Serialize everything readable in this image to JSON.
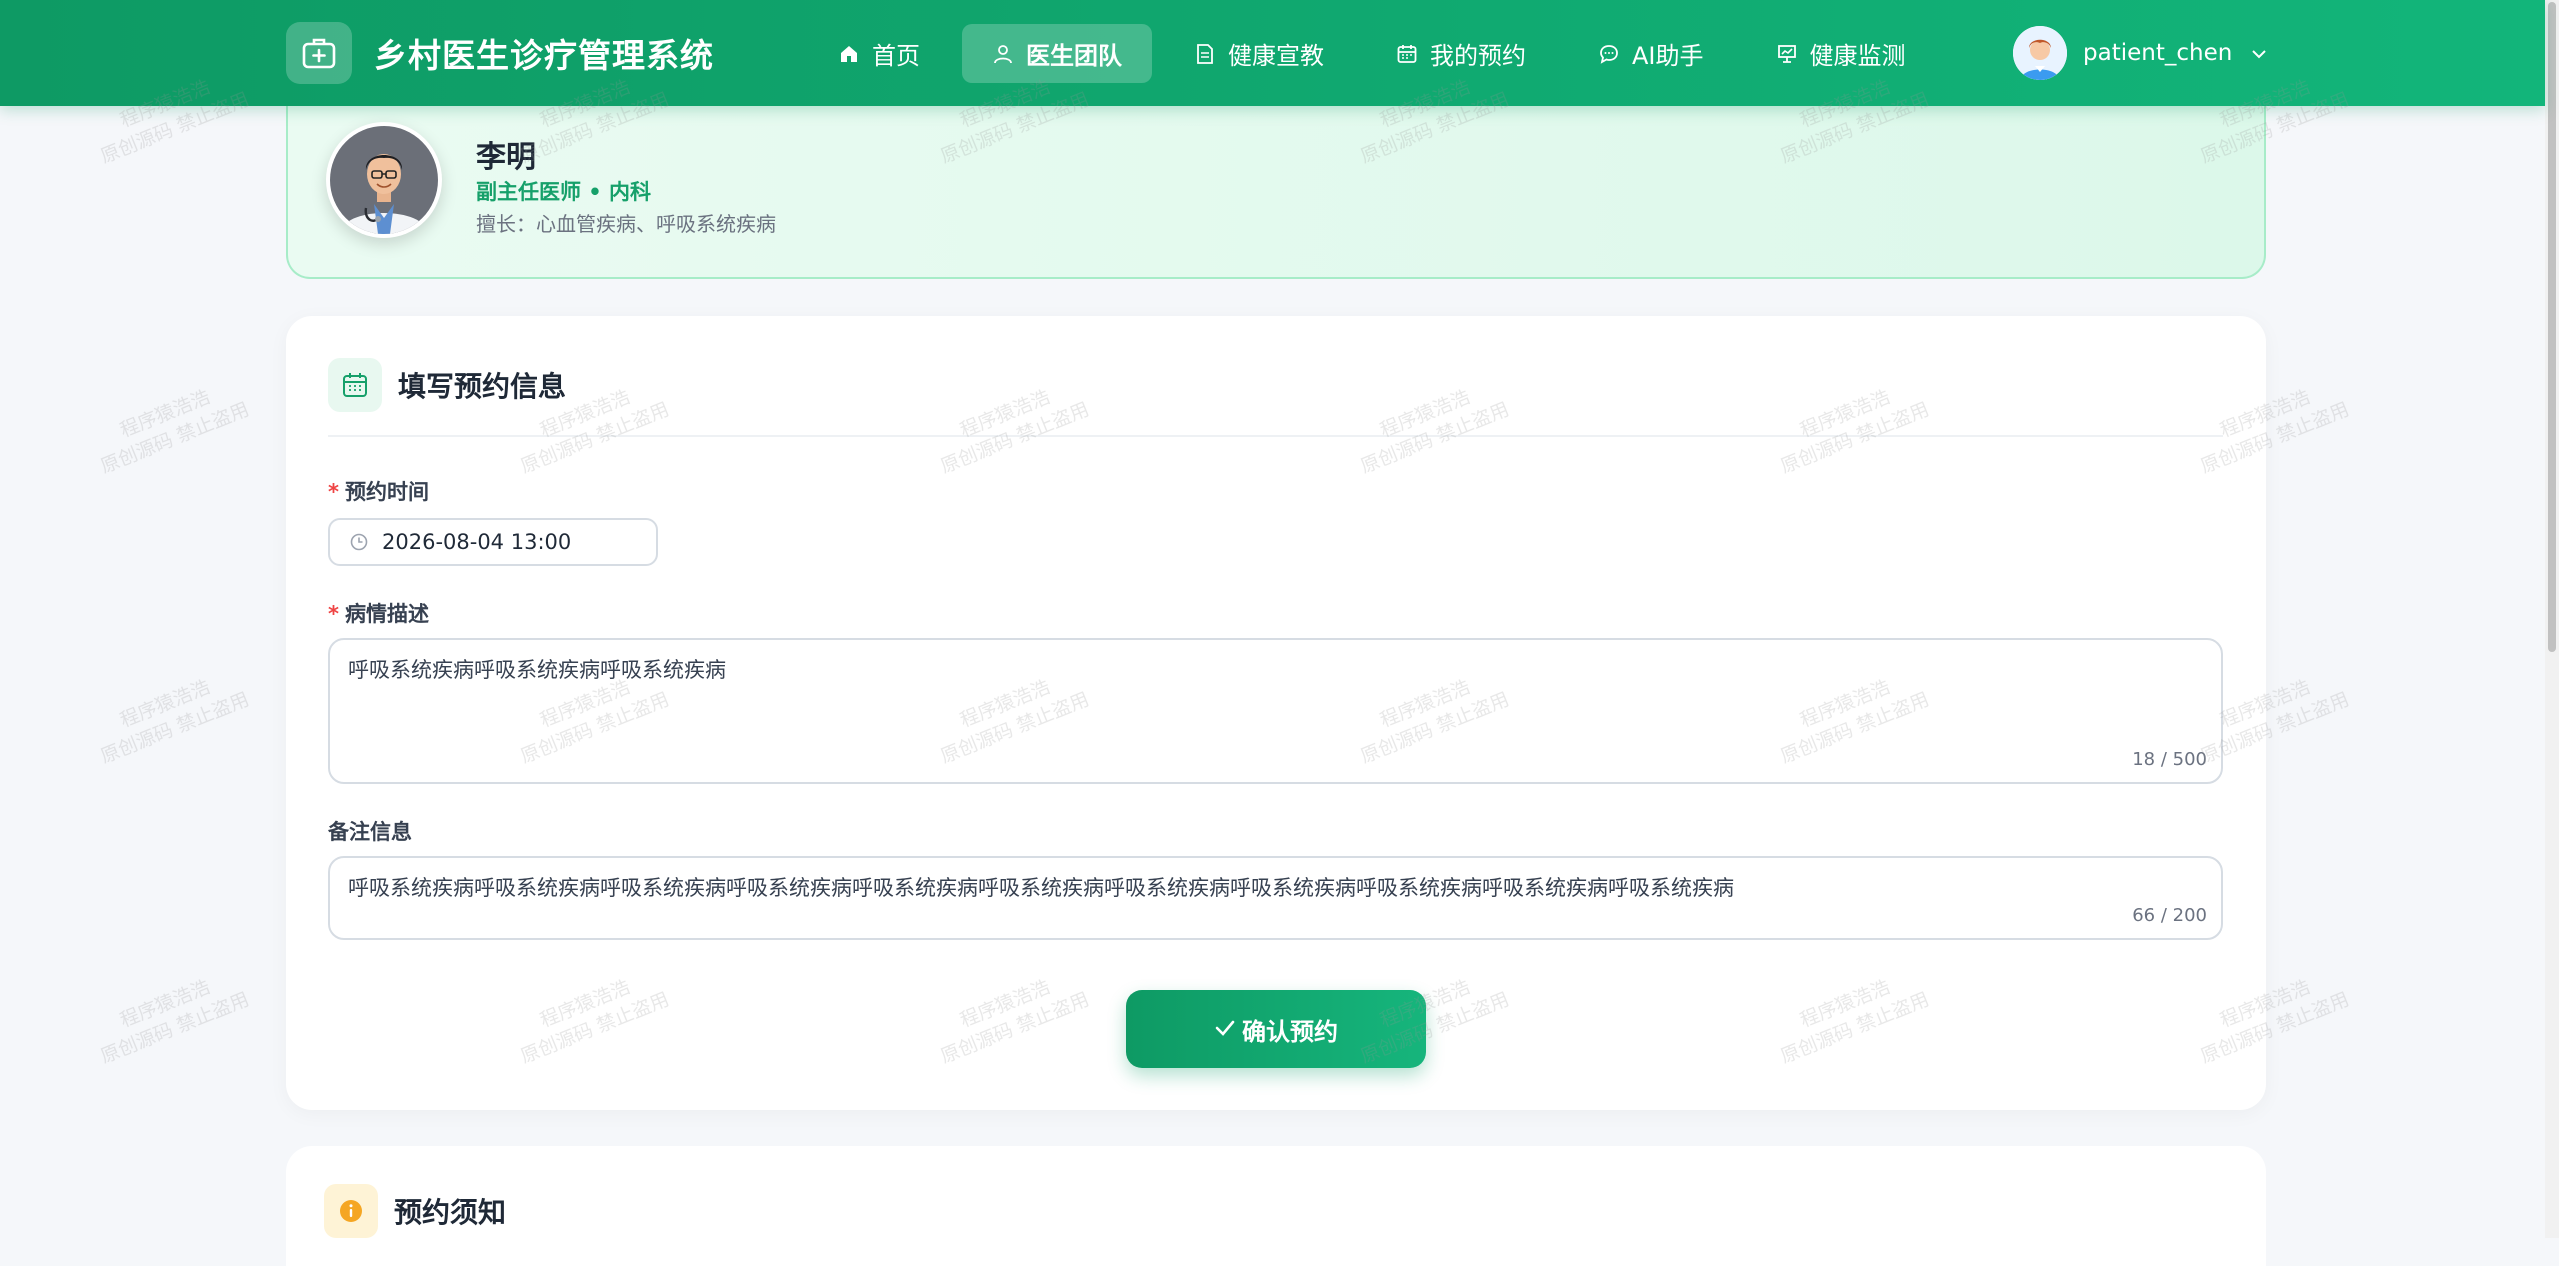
{
  "header": {
    "brand_title": "乡村医生诊疗管理系统",
    "nav": [
      {
        "label": "首页",
        "icon": "home-icon"
      },
      {
        "label": "医生团队",
        "icon": "user-icon",
        "active": true
      },
      {
        "label": "健康宣教",
        "icon": "document-icon"
      },
      {
        "label": "我的预约",
        "icon": "calendar-icon"
      },
      {
        "label": "AI助手",
        "icon": "chat-icon"
      },
      {
        "label": "健康监测",
        "icon": "monitor-icon"
      }
    ],
    "username": "patient_chen"
  },
  "doctor": {
    "name": "李明",
    "title": "副主任医师 • 内科",
    "specialty": "擅长：心血管疾病、呼吸系统疾病"
  },
  "form": {
    "section_title": "填写预约信息",
    "time_label": "预约时间",
    "time_value": "2026-08-04 13:00",
    "desc_label": "病情描述",
    "desc_value": "呼吸系统疾病呼吸系统疾病呼吸系统疾病",
    "desc_counter": "18 / 500",
    "remark_label": "备注信息",
    "remark_value": "呼吸系统疾病呼吸系统疾病呼吸系统疾病呼吸系统疾病呼吸系统疾病呼吸系统疾病呼吸系统疾病呼吸系统疾病呼吸系统疾病呼吸系统疾病呼吸系统疾病",
    "remark_counter": "66 / 200",
    "submit_label": "确认预约"
  },
  "notice": {
    "title": "预约须知"
  },
  "watermark": {
    "line1": "程序猿浩浩",
    "line2": "原创源码 禁止盗用"
  },
  "colors": {
    "brand": "#0e9a64",
    "accent": "#16a06a",
    "required": "#ef4444"
  }
}
